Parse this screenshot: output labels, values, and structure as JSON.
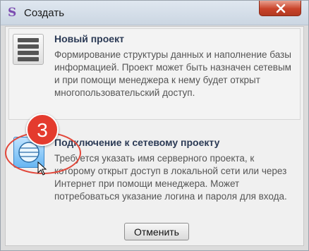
{
  "window": {
    "title": "Создать",
    "app_icon_glyph": "S",
    "accent_color": "#c9432a"
  },
  "options": [
    {
      "title": "Новый проект",
      "description": "Формирование структуры данных и наполнение базы информацией. Проект может быть назначен сетевым и при помощи менеджера к нему будет открыт многопользовательский доступ.",
      "icon": "database-icon"
    },
    {
      "title": "Подключение к сетевому проекту",
      "description": "Требуется указать имя серверного проекта, к которому открыт доступ в локальной сети или через Интернет при помощи менеджера. Может потребоваться указание логина и пароля для входа.",
      "icon": "network-icon"
    }
  ],
  "cancel_label": "Отменить",
  "step_marker": {
    "number": "3",
    "color": "#e43b2e"
  }
}
